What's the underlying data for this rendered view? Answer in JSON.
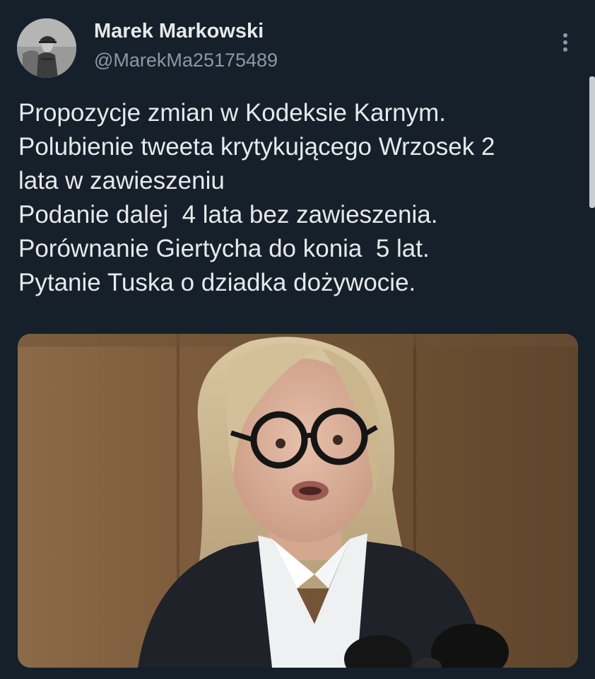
{
  "author": {
    "display_name": "Marek Markowski",
    "handle": "@MarekMa25175489"
  },
  "tweet": {
    "lines": [
      "Propozycje zmian w Kodeksie Karnym.",
      "Polubienie tweeta krytykującego Wrzosek 2",
      "lata w zawieszeniu",
      "Podanie dalej  4 lata bez zawieszenia.",
      "Porównanie Giertycha do konia  5 lat.",
      "Pytanie Tuska o dziadka dożywocie."
    ]
  },
  "icons": {
    "more": "more-vertical-icon",
    "avatar": "avatar-soldier-photo"
  },
  "colors": {
    "background": "#15202b",
    "text": "#e7e9ea",
    "secondary_text": "#8b98a5"
  }
}
